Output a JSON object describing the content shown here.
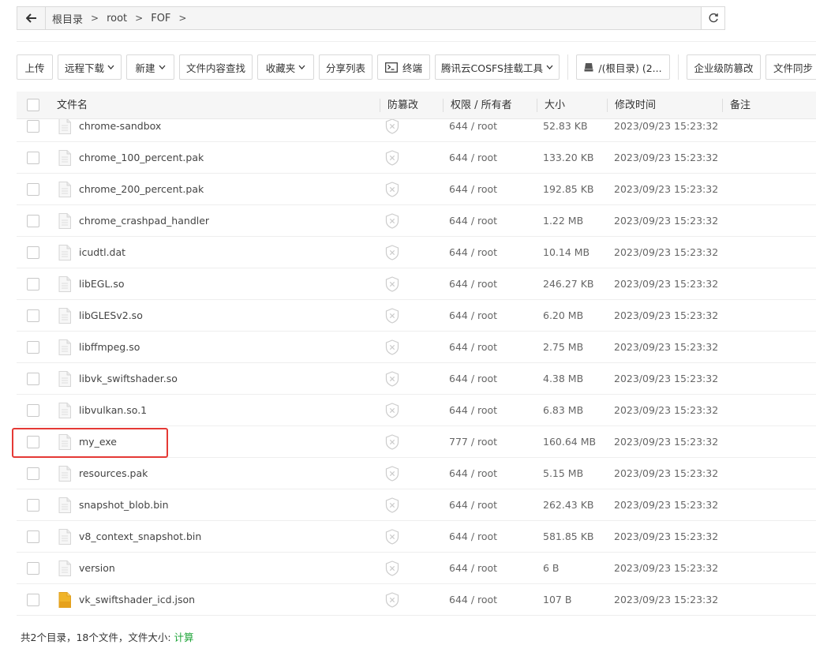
{
  "breadcrumb": {
    "items": [
      "根目录",
      "root",
      "FOF"
    ]
  },
  "toolbar": {
    "upload": "上传",
    "remote_download": "远程下载",
    "new": "新建",
    "content_search": "文件内容查找",
    "favorites": "收藏夹",
    "share_list": "分享列表",
    "terminal": "终端",
    "cosfs": "腾讯云COSFS挂载工具",
    "disk": "/(根目录) (2...",
    "tamper_proof": "企业级防篡改",
    "file_sync": "文件同步"
  },
  "table": {
    "headers": {
      "name": "文件名",
      "tamper": "防篡改",
      "perm": "权限 / 所有者",
      "size": "大小",
      "mtime": "修改时间",
      "note": "备注"
    },
    "rows": [
      {
        "name": "chrome-sandbox",
        "perm": "644 / root",
        "size": "52.83 KB",
        "mtime": "2023/09/23 15:23:32",
        "icon": "file-icon"
      },
      {
        "name": "chrome_100_percent.pak",
        "perm": "644 / root",
        "size": "133.20 KB",
        "mtime": "2023/09/23 15:23:32",
        "icon": "file-icon"
      },
      {
        "name": "chrome_200_percent.pak",
        "perm": "644 / root",
        "size": "192.85 KB",
        "mtime": "2023/09/23 15:23:32",
        "icon": "file-icon"
      },
      {
        "name": "chrome_crashpad_handler",
        "perm": "644 / root",
        "size": "1.22 MB",
        "mtime": "2023/09/23 15:23:32",
        "icon": "file-icon"
      },
      {
        "name": "icudtl.dat",
        "perm": "644 / root",
        "size": "10.14 MB",
        "mtime": "2023/09/23 15:23:32",
        "icon": "file-icon"
      },
      {
        "name": "libEGL.so",
        "perm": "644 / root",
        "size": "246.27 KB",
        "mtime": "2023/09/23 15:23:32",
        "icon": "file-icon"
      },
      {
        "name": "libGLESv2.so",
        "perm": "644 / root",
        "size": "6.20 MB",
        "mtime": "2023/09/23 15:23:32",
        "icon": "file-icon"
      },
      {
        "name": "libffmpeg.so",
        "perm": "644 / root",
        "size": "2.75 MB",
        "mtime": "2023/09/23 15:23:32",
        "icon": "file-icon"
      },
      {
        "name": "libvk_swiftshader.so",
        "perm": "644 / root",
        "size": "4.38 MB",
        "mtime": "2023/09/23 15:23:32",
        "icon": "file-icon"
      },
      {
        "name": "libvulkan.so.1",
        "perm": "644 / root",
        "size": "6.83 MB",
        "mtime": "2023/09/23 15:23:32",
        "icon": "file-icon"
      },
      {
        "name": "my_exe",
        "perm": "777 / root",
        "size": "160.64 MB",
        "mtime": "2023/09/23 15:23:32",
        "icon": "file-icon"
      },
      {
        "name": "resources.pak",
        "perm": "644 / root",
        "size": "5.15 MB",
        "mtime": "2023/09/23 15:23:32",
        "icon": "file-icon"
      },
      {
        "name": "snapshot_blob.bin",
        "perm": "644 / root",
        "size": "262.43 KB",
        "mtime": "2023/09/23 15:23:32",
        "icon": "file-icon"
      },
      {
        "name": "v8_context_snapshot.bin",
        "perm": "644 / root",
        "size": "581.85 KB",
        "mtime": "2023/09/23 15:23:32",
        "icon": "file-icon"
      },
      {
        "name": "version",
        "perm": "644 / root",
        "size": "6 B",
        "mtime": "2023/09/23 15:23:32",
        "icon": "file-icon"
      },
      {
        "name": "vk_swiftshader_icd.json",
        "perm": "644 / root",
        "size": "107 B",
        "mtime": "2023/09/23 15:23:32",
        "icon": "json-file-icon"
      }
    ]
  },
  "footer": {
    "summary": "共2个目录，18个文件，文件大小: ",
    "calc": "计算"
  },
  "colors": {
    "accent": "#20a53a",
    "highlight": "#e53935",
    "json_icon": "#f0b429"
  }
}
